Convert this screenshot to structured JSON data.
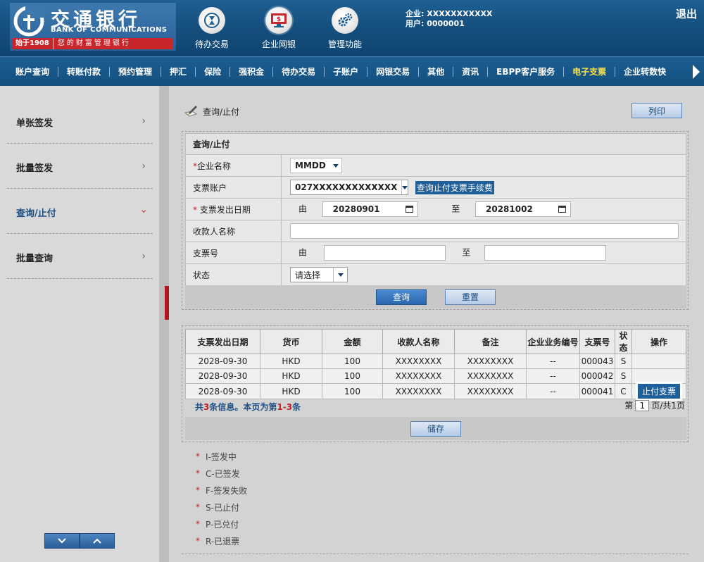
{
  "brand": {
    "name_cn": "交通银行",
    "name_en": "BANK OF COMMUNICATIONS",
    "since": "始于1908",
    "slogan": "您的财富管理银行"
  },
  "header": {
    "buttons": [
      {
        "label": "待办交易",
        "icon": "hourglass-icon"
      },
      {
        "label": "企业网银",
        "icon": "monitor-icon"
      },
      {
        "label": "管理功能",
        "icon": "gears-icon"
      }
    ],
    "company_label": "企业: XXXXXXXXXXX",
    "user_label": "用户: 0000001",
    "logout": "退出"
  },
  "nav": {
    "items": [
      "账户查询",
      "转账付款",
      "预约管理",
      "押汇",
      "保险",
      "强积金",
      "待办交易",
      "子账户",
      "网银交易",
      "其他",
      "资讯",
      "EBPP客户服务",
      "电子支票",
      "企业转数快"
    ],
    "active": "电子支票"
  },
  "sidebar": {
    "items": [
      "单张签发",
      "批量签发",
      "查询/止付",
      "批量查询"
    ],
    "active": "查询/止付"
  },
  "page": {
    "title": "查询/止付",
    "print": "列印"
  },
  "form": {
    "title": "查询/止付",
    "company_label": "企业名称",
    "company_value": "MMDD",
    "account_label": "支票账户",
    "account_value": "027XXXXXXXXXXXXX",
    "fee_link": "查询止付支票手续费",
    "date_label": "支票发出日期",
    "from": "由",
    "to": "至",
    "date_from": "20280901",
    "date_to": "20281002",
    "payee_label": "收款人名称",
    "cheque_label": "支票号",
    "status_label": "状态",
    "status_value": "请选择",
    "required_mark": "*",
    "search": "查询",
    "reset": "重置"
  },
  "results": {
    "columns": [
      "支票发出日期",
      "货币",
      "金额",
      "收款人名称",
      "备注",
      "企业业务编号",
      "支票号",
      "状态",
      "操作"
    ],
    "rows": [
      {
        "date": "2028-09-30",
        "currency": "HKD",
        "amount": "100",
        "payee": "XXXXXXXX",
        "remark": "XXXXXXXX",
        "ref": "--",
        "cheque": "000043",
        "status": "S",
        "action": ""
      },
      {
        "date": "2028-09-30",
        "currency": "HKD",
        "amount": "100",
        "payee": "XXXXXXXX",
        "remark": "XXXXXXXX",
        "ref": "--",
        "cheque": "000042",
        "status": "S",
        "action": ""
      },
      {
        "date": "2028-09-30",
        "currency": "HKD",
        "amount": "100",
        "payee": "XXXXXXXX",
        "remark": "XXXXXXXX",
        "ref": "--",
        "cheque": "000041",
        "status": "C",
        "action": "止付支票"
      }
    ],
    "summary": {
      "prefix": "共",
      "total": "3",
      "mid": "条信息。本页为第",
      "range": "1-3",
      "suffix": "条"
    },
    "pager": {
      "prefix": "第",
      "page": "1",
      "suffix": "页/共1页"
    },
    "save": "储存"
  },
  "legend": [
    "I-签发中",
    "C-已签发",
    "F-签发失败",
    "S-已止付",
    "P-已兑付",
    "R-已退票"
  ]
}
